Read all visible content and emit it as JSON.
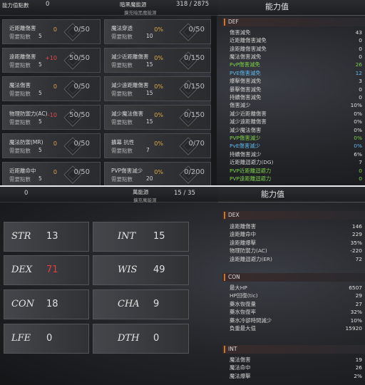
{
  "top": {
    "points_label": "能力值點數",
    "points_value": "0",
    "mid_label": "暗黑魔能源",
    "mid_sub": "擴充暗黑魔能源",
    "mid_value": "318 / 2875",
    "panel_title": "能力值",
    "need_label": "需要點數",
    "cards_left": [
      {
        "name": "近距離傷害",
        "need": "5",
        "bonus": "0",
        "progress": "0/50"
      },
      {
        "name": "遠距離傷害",
        "need": "5",
        "bonus": "+10",
        "progress": "50/50"
      },
      {
        "name": "魔法傷害",
        "need": "5",
        "bonus": "0",
        "progress": "0/50"
      },
      {
        "name": "物理防禦力(AC)",
        "need": "5",
        "bonus": "-10",
        "progress": "50/50"
      },
      {
        "name": "魔法防禦(MR)",
        "need": "5",
        "bonus": "0",
        "progress": "0/50"
      },
      {
        "name": "近距離命中",
        "need": "5",
        "bonus": "0",
        "progress": "0/50"
      }
    ],
    "cards_right": [
      {
        "name": "魔法穿透",
        "need": "10",
        "bonus": "0%",
        "progress": "0/50"
      },
      {
        "name": "減少近距離傷害",
        "need": "15",
        "bonus": "0%",
        "progress": "0/150"
      },
      {
        "name": "減少遠距離傷害",
        "need": "15",
        "bonus": "0%",
        "progress": "0/150"
      },
      {
        "name": "減少魔法傷害",
        "need": "15",
        "bonus": "0%",
        "progress": "0/150"
      },
      {
        "name": "擴幕 抗性",
        "need": "7",
        "bonus": "0%",
        "progress": "0/70"
      },
      {
        "name": "PVP傷害減少",
        "need": "20",
        "bonus": "0%",
        "progress": "0/200"
      }
    ],
    "def_section": "DEF",
    "def_stats": [
      {
        "label": "傷害減免",
        "value": "43",
        "color": "#d2d2d2"
      },
      {
        "label": "近距離傷害減免",
        "value": "0",
        "color": "#d2d2d2"
      },
      {
        "label": "遠距離傷害減免",
        "value": "0",
        "color": "#d2d2d2"
      },
      {
        "label": "魔法傷害減免",
        "value": "0",
        "color": "#d2d2d2"
      },
      {
        "label": "PvP傷害減免",
        "value": "26",
        "color": "#7fd14a"
      },
      {
        "label": "PVE傷害減免",
        "value": "12",
        "color": "#5fb7ea"
      },
      {
        "label": "爆擊傷害減免",
        "value": "3",
        "color": "#d2d2d2"
      },
      {
        "label": "暴擊傷害減免",
        "value": "0",
        "color": "#d2d2d2"
      },
      {
        "label": "持續傷害減免",
        "value": "0",
        "color": "#d2d2d2"
      },
      {
        "label": "傷害減少",
        "value": "10%",
        "color": "#d2d2d2"
      },
      {
        "label": "減少近距離傷害",
        "value": "0%",
        "color": "#d2d2d2"
      },
      {
        "label": "減少遠距離傷害",
        "value": "0%",
        "color": "#d2d2d2"
      },
      {
        "label": "減少魔法傷害",
        "value": "0%",
        "color": "#d2d2d2"
      },
      {
        "label": "PVP傷害減少",
        "value": "0%",
        "color": "#7fd14a"
      },
      {
        "label": "PvE傷害減少",
        "value": "0%",
        "color": "#5fb7ea"
      },
      {
        "label": "持續傷害減少",
        "value": "6%",
        "color": "#d2d2d2"
      },
      {
        "label": "近距離迴避力(DG)",
        "value": "7",
        "color": "#d2d2d2"
      },
      {
        "label": "PVP近距離迴避力",
        "value": "0",
        "color": "#7fd14a"
      },
      {
        "label": "PVP遠距離迴避力",
        "value": "0",
        "color": "#7fd14a"
      }
    ]
  },
  "bottom": {
    "points_value": "0",
    "mid_label": "萬能源",
    "mid_sub": "擴充萬能源",
    "mid_value": "15 / 35",
    "panel_title": "能力值",
    "tiles": [
      {
        "label": "STR",
        "value": "13",
        "color": "#e0e0e0"
      },
      {
        "label": "INT",
        "value": "15",
        "color": "#e0e0e0"
      },
      {
        "label": "DEX",
        "value": "71",
        "color": "#e04040"
      },
      {
        "label": "WIS",
        "value": "49",
        "color": "#e0e0e0"
      },
      {
        "label": "CON",
        "value": "18",
        "color": "#e0e0e0"
      },
      {
        "label": "CHA",
        "value": "9",
        "color": "#e0e0e0"
      },
      {
        "label": "LFE",
        "value": "0",
        "color": "#e0e0e0"
      },
      {
        "label": "DTH",
        "value": "0",
        "color": "#e0e0e0"
      }
    ],
    "dex_section": "DEX",
    "dex_stats": [
      {
        "label": "遠距離傷害",
        "value": "146"
      },
      {
        "label": "遠距離命中",
        "value": "229"
      },
      {
        "label": "遠距離爆擊",
        "value": "35%"
      },
      {
        "label": "物理防禦力(AC)",
        "value": "-220"
      },
      {
        "label": "遠距離迴避力(ER)",
        "value": "72"
      }
    ],
    "con_section": "CON",
    "con_stats": [
      {
        "label": "最大HP",
        "value": "6507"
      },
      {
        "label": "HP回復(tic)",
        "value": "29"
      },
      {
        "label": "藥水恢復量",
        "value": "27"
      },
      {
        "label": "藥水恢復率",
        "value": "32%"
      },
      {
        "label": "藥水冷卻時間減少",
        "value": "10%"
      },
      {
        "label": "負重最大值",
        "value": "15920"
      }
    ],
    "int_section": "INT",
    "int_stats": [
      {
        "label": "魔法傷害",
        "value": "19"
      },
      {
        "label": "魔法命中",
        "value": "26"
      },
      {
        "label": "魔法爆擊",
        "value": "2%"
      }
    ]
  }
}
